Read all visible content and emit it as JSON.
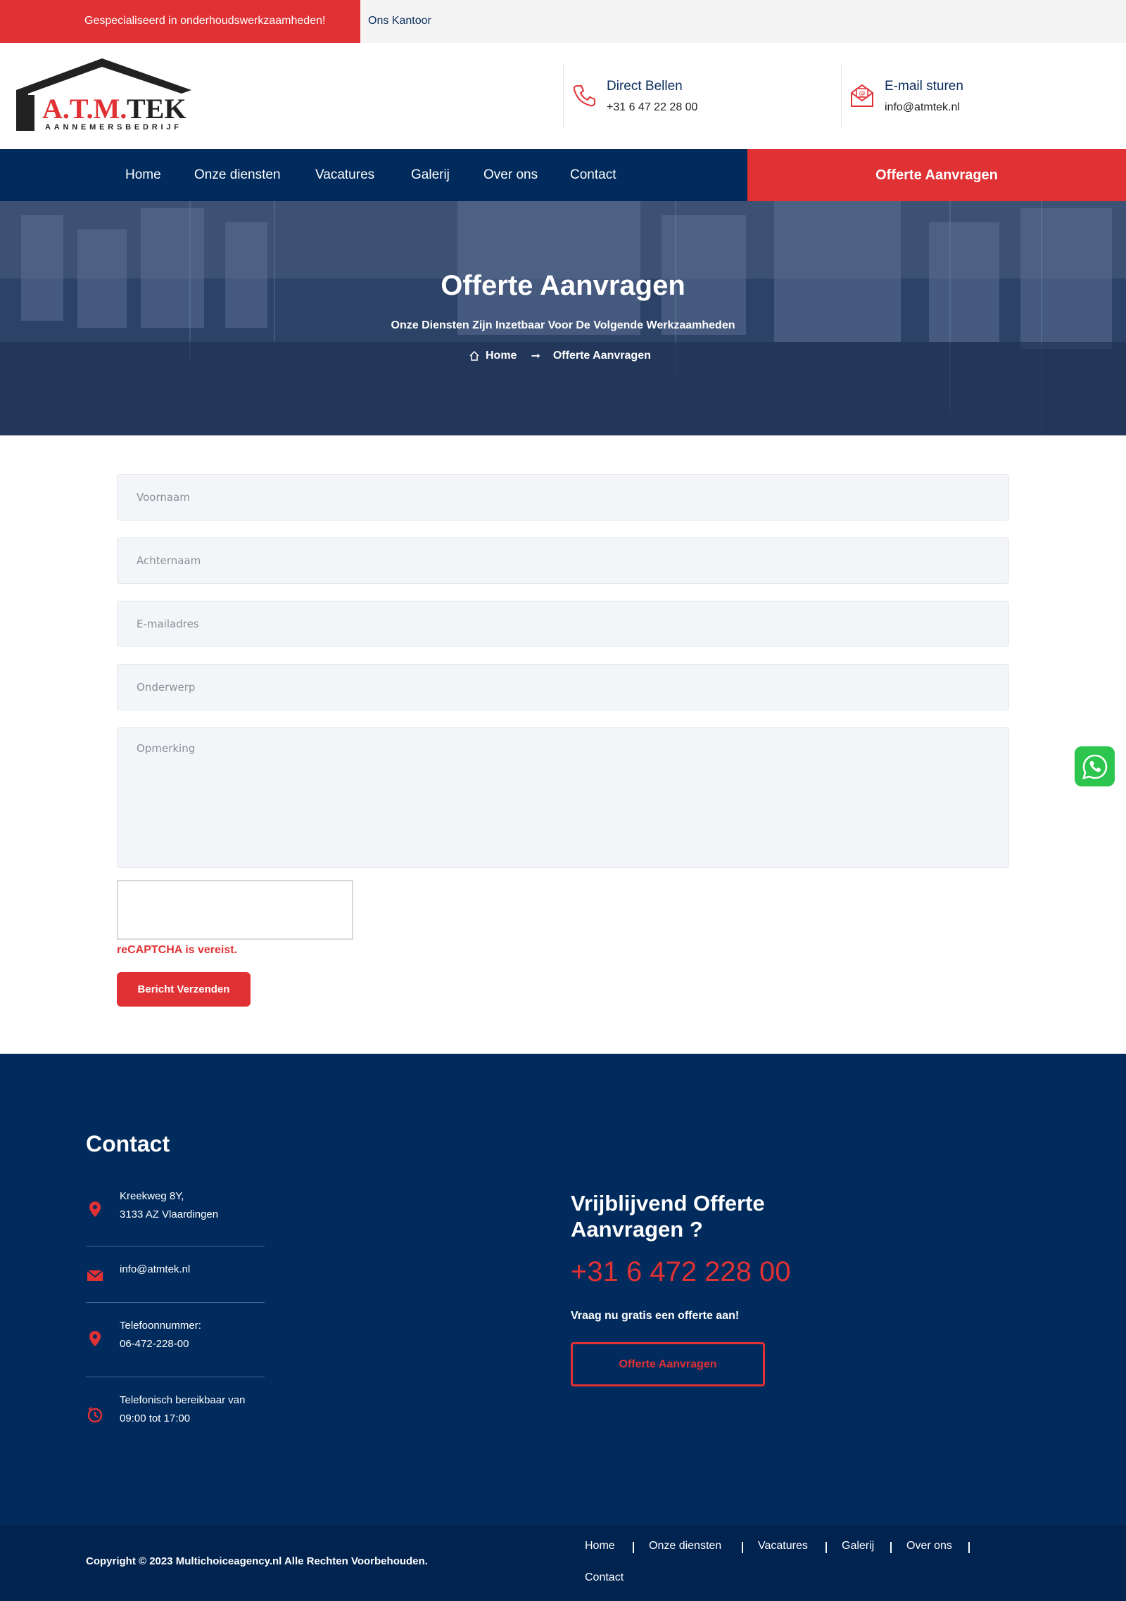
{
  "topbar": {
    "tagline": "Gespecialiseerd in onderhoudswerkzaamheden!",
    "office": "Ons Kantoor"
  },
  "logo": {
    "brand": "A.T.M.TEK",
    "sub": "AANNEMERSBEDRIJF"
  },
  "header": {
    "call_title": "Direct Bellen",
    "call_value": "+31 6 47 22 28 00",
    "mail_title": "E-mail sturen",
    "mail_value": "info@atmtek.nl"
  },
  "nav": {
    "items": [
      "Home",
      "Onze diensten",
      "Vacatures",
      "Galerij",
      "Over ons",
      "Contact"
    ],
    "cta": "Offerte Aanvragen"
  },
  "hero": {
    "title": "Offerte Aanvragen",
    "subtitle": "Onze Diensten Zijn Inzetbaar Voor De Volgende Werkzaamheden",
    "breadcrumb_home": "Home",
    "breadcrumb_current": "Offerte Aanvragen"
  },
  "form": {
    "firstname_ph": "Voornaam",
    "lastname_ph": "Achternaam",
    "email_ph": "E-mailadres",
    "subject_ph": "Onderwerp",
    "remark_ph": "Opmerking",
    "captcha_error": "reCAPTCHA is vereist.",
    "submit": "Bericht Verzenden"
  },
  "footer": {
    "contact_title": "Contact",
    "address_l1": "Kreekweg 8Y,",
    "address_l2": "3133 AZ Vlaardingen",
    "email": "info@atmtek.nl",
    "phone_label": "Telefoonnummer:",
    "phone_value": "06-472-228-00",
    "hours_l1": "Telefonisch bereikbaar van",
    "hours_l2": "09:00 tot 17:00",
    "cta_title": "Vrijblijvend Offerte Aanvragen ?",
    "cta_phone": "+31 6 472 228 00",
    "cta_sub": "Vraag nu gratis een offerte aan!",
    "cta_button": "Offerte Aanvragen",
    "copyright": "Copyright © 2023 Multichoiceagency.nl Alle Rechten Voorbehouden.",
    "links": [
      "Home",
      "Onze diensten",
      "Vacatures",
      "Galerij",
      "Over ons",
      "Contact"
    ]
  },
  "colors": {
    "brand_red": "#e03134",
    "brand_navy": "#002b5c"
  },
  "icons": [
    "phone-icon",
    "envelope-icon",
    "home-icon",
    "arrow-right-icon",
    "location-pin-icon",
    "mail-icon",
    "clock-icon",
    "whatsapp-icon"
  ]
}
